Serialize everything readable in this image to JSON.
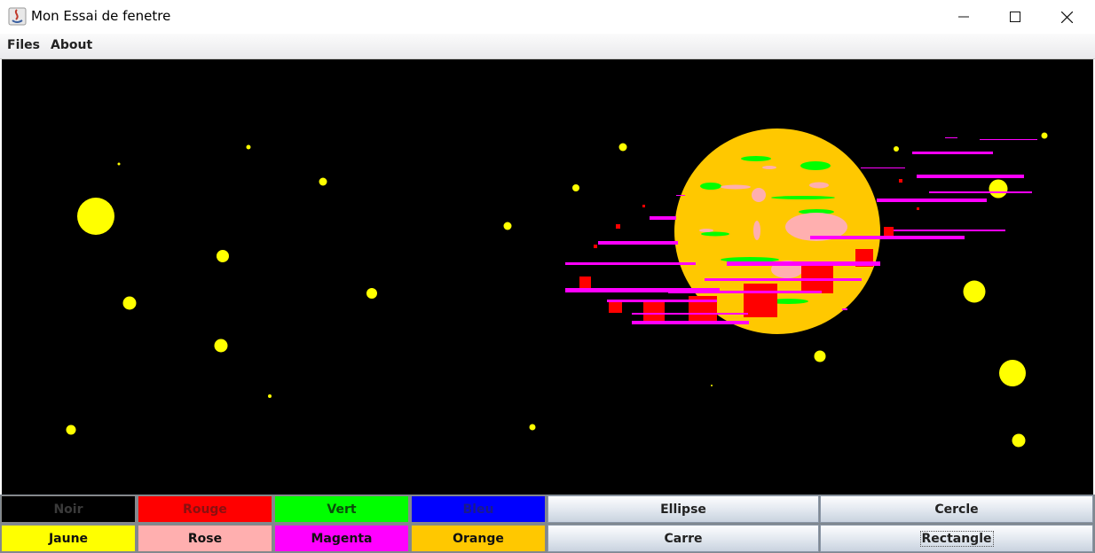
{
  "window": {
    "title": "Mon Essai de fenetre"
  },
  "menu": {
    "items": [
      "Files",
      "About"
    ]
  },
  "palette": {
    "buttons": [
      {
        "label": "Noir",
        "bg": "#000000",
        "fg": "#3a3a3a"
      },
      {
        "label": "Rouge",
        "bg": "#ff0000",
        "fg": "#8a1010"
      },
      {
        "label": "Vert",
        "bg": "#00ff00",
        "fg": "#0b4d0b"
      },
      {
        "label": "Bleu",
        "bg": "#0000ff",
        "fg": "#1a1a8c"
      },
      {
        "label": "Jaune",
        "bg": "#ffff00",
        "fg": "#111111"
      },
      {
        "label": "Rose",
        "bg": "#ffafaf",
        "fg": "#111111"
      },
      {
        "label": "Magenta",
        "bg": "#ff00ff",
        "fg": "#111111"
      },
      {
        "label": "Orange",
        "bg": "#ffc800",
        "fg": "#111111"
      }
    ]
  },
  "shapes": {
    "buttons": [
      "Ellipse",
      "Cercle",
      "Carre",
      "Rectangle"
    ],
    "focused": "Rectangle"
  },
  "canvas": {
    "background": "#000000",
    "colors": {
      "yellow": "#ffff00",
      "orange": "#ffc800",
      "green": "#00ff00",
      "pink": "#ffafaf",
      "red": "#ff0000",
      "magenta": "#ff00ff"
    }
  }
}
